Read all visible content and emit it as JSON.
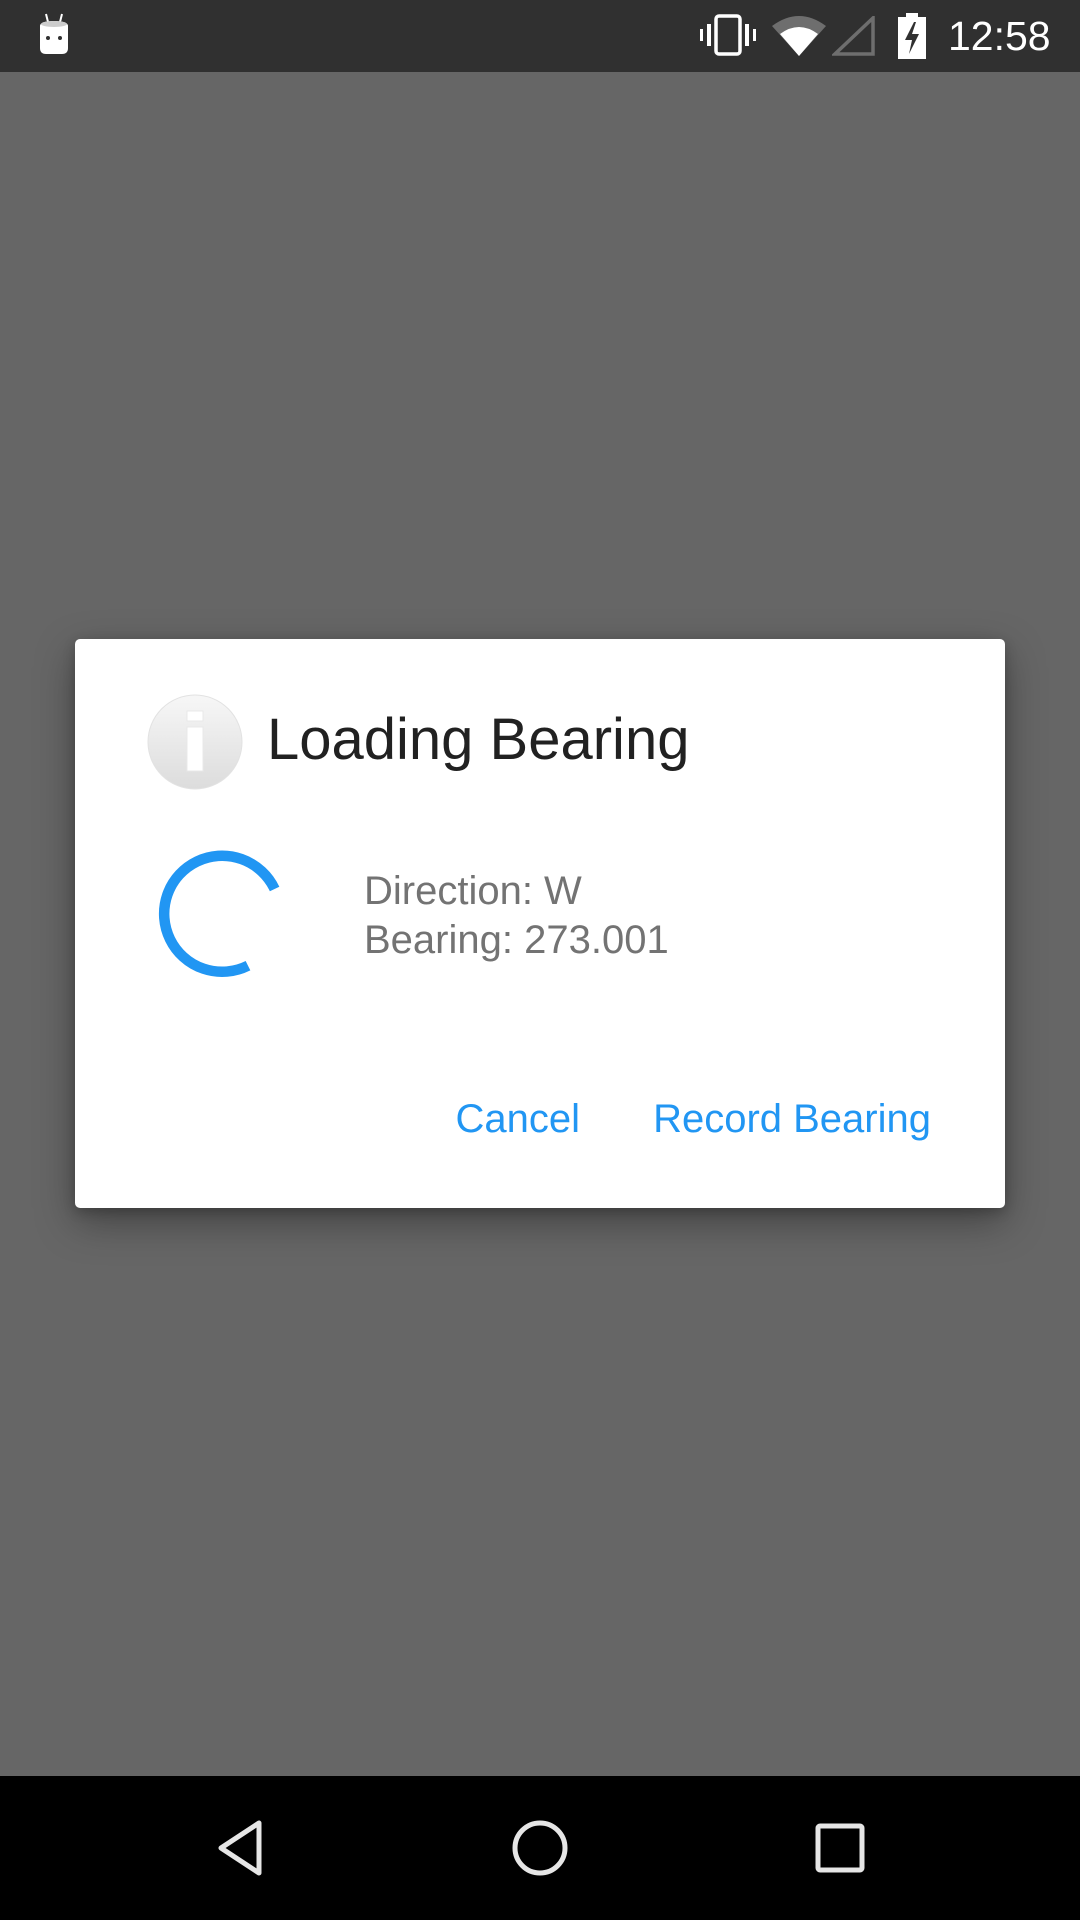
{
  "status_bar": {
    "notification_icon": "android-icon",
    "icons": [
      "vibrate-icon",
      "wifi-icon",
      "cell-signal-icon",
      "battery-charging-icon"
    ],
    "time": "12:58"
  },
  "dialog": {
    "icon": "info-icon",
    "title": "Loading Bearing",
    "spinner": "progress-spinner",
    "message_lines": [
      "Direction: W",
      "Bearing: 273.001"
    ],
    "buttons": {
      "cancel": "Cancel",
      "record": "Record Bearing"
    },
    "accent_color": "#2196F3"
  },
  "nav_bar": {
    "buttons": [
      "back-icon",
      "home-icon",
      "recents-icon"
    ]
  },
  "colors": {
    "backdrop": "#666666",
    "status_bar": "#303030",
    "nav_bar": "#000000",
    "title_text": "#212121",
    "message_text": "#737373"
  }
}
